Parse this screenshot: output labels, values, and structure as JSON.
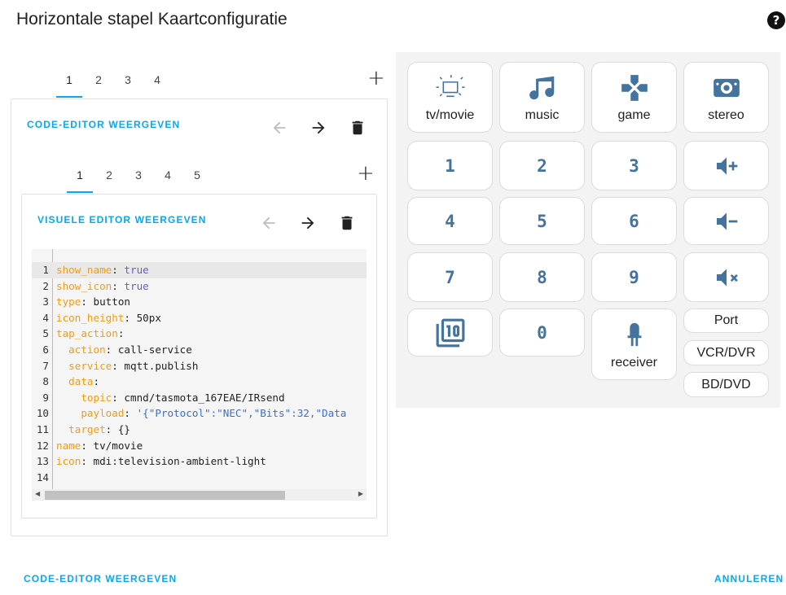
{
  "dialog": {
    "title": "Horizontale stapel Kaartconfiguratie",
    "help_label": "?"
  },
  "outer_tabs": [
    "1",
    "2",
    "3",
    "4"
  ],
  "outer_active_tab": "1",
  "outer_card": {
    "toggle_label": "CODE-EDITOR WEERGEVEN"
  },
  "inner_tabs": [
    "1",
    "2",
    "3",
    "4",
    "5"
  ],
  "inner_active_tab": "1",
  "inner_card": {
    "toggle_label": "VISUELE EDITOR WEERGEVEN"
  },
  "code_lines": [
    {
      "n": "1",
      "parts": [
        [
          "k",
          "show_name"
        ],
        [
          "p",
          ": "
        ],
        [
          "b",
          "true"
        ]
      ]
    },
    {
      "n": "2",
      "parts": [
        [
          "k",
          "show_icon"
        ],
        [
          "p",
          ": "
        ],
        [
          "b",
          "true"
        ]
      ]
    },
    {
      "n": "3",
      "parts": [
        [
          "k",
          "type"
        ],
        [
          "p",
          ": button"
        ]
      ]
    },
    {
      "n": "4",
      "parts": [
        [
          "k",
          "icon_height"
        ],
        [
          "p",
          ": 50px"
        ]
      ]
    },
    {
      "n": "5",
      "parts": [
        [
          "k",
          "tap_action"
        ],
        [
          "p",
          ":"
        ]
      ]
    },
    {
      "n": "6",
      "parts": [
        [
          "p",
          "  "
        ],
        [
          "k",
          "action"
        ],
        [
          "p",
          ": call-service"
        ]
      ]
    },
    {
      "n": "7",
      "parts": [
        [
          "p",
          "  "
        ],
        [
          "k",
          "service"
        ],
        [
          "p",
          ": mqtt.publish"
        ]
      ]
    },
    {
      "n": "8",
      "parts": [
        [
          "p",
          "  "
        ],
        [
          "k",
          "data"
        ],
        [
          "p",
          ":"
        ]
      ]
    },
    {
      "n": "9",
      "parts": [
        [
          "p",
          "    "
        ],
        [
          "k",
          "topic"
        ],
        [
          "p",
          ": cmnd/tasmota_167EAE/IRsend"
        ]
      ]
    },
    {
      "n": "10",
      "parts": [
        [
          "p",
          "    "
        ],
        [
          "k",
          "payload"
        ],
        [
          "p",
          ": "
        ],
        [
          "s",
          "'{\"Protocol\":\"NEC\",\"Bits\":32,\"Data"
        ]
      ]
    },
    {
      "n": "11",
      "parts": [
        [
          "p",
          "  "
        ],
        [
          "k",
          "target"
        ],
        [
          "p",
          ": {}"
        ]
      ]
    },
    {
      "n": "12",
      "parts": [
        [
          "k",
          "name"
        ],
        [
          "p",
          ": tv/movie"
        ]
      ]
    },
    {
      "n": "13",
      "parts": [
        [
          "k",
          "icon"
        ],
        [
          "p",
          ": mdi:television-ambient-light"
        ]
      ]
    },
    {
      "n": "14",
      "parts": []
    }
  ],
  "remote": {
    "row1": [
      {
        "label": "tv/movie",
        "icon": "television-ambient-light-icon"
      },
      {
        "label": "music",
        "icon": "music-note-icon"
      },
      {
        "label": "game",
        "icon": "gamepad-icon"
      },
      {
        "label": "stereo",
        "icon": "speaker-icon"
      }
    ],
    "digits": [
      "1",
      "2",
      "3",
      "4",
      "5",
      "6",
      "7",
      "8",
      "9",
      "0"
    ],
    "volume": [
      "volume-plus-icon",
      "volume-minus-icon",
      "volume-mute-icon"
    ],
    "pages_icon": "numeric-10-box-multiple-icon",
    "receiver": {
      "label": "receiver",
      "icon": "led-icon"
    },
    "sources": [
      "Port",
      "VCR/DVR",
      "BD/DVD"
    ]
  },
  "footer": {
    "left_label": "CODE-EDITOR WEERGEVEN",
    "right_label": "ANNULEREN"
  },
  "colors": {
    "accent": "#03a9f4",
    "icon": "#44739e",
    "key": "#f39c12",
    "bool": "#6a5acd",
    "string": "#3b6fd0"
  }
}
